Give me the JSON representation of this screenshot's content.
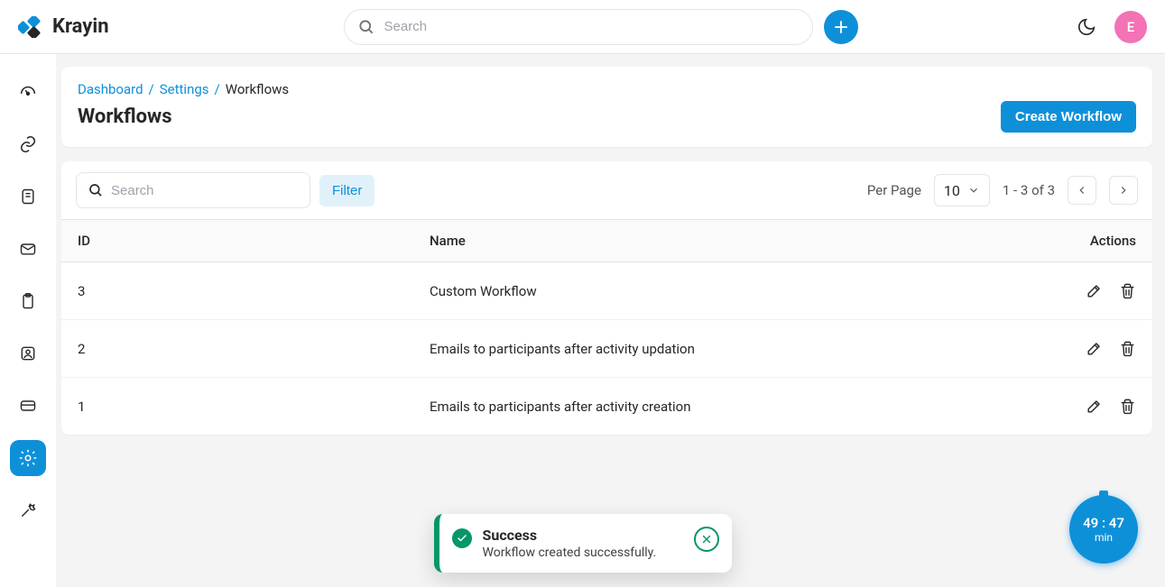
{
  "brand": {
    "name": "Krayin"
  },
  "header": {
    "search_placeholder": "Search",
    "avatar_initial": "E"
  },
  "sidebar": {
    "items": [
      {
        "name": "dashboard-icon"
      },
      {
        "name": "leads-icon"
      },
      {
        "name": "quotes-icon"
      },
      {
        "name": "mail-icon"
      },
      {
        "name": "activities-icon"
      },
      {
        "name": "contacts-icon"
      },
      {
        "name": "products-icon"
      },
      {
        "name": "settings-icon"
      },
      {
        "name": "configuration-icon"
      }
    ]
  },
  "breadcrumb": {
    "dashboard": "Dashboard",
    "settings": "Settings",
    "current": "Workflows"
  },
  "page": {
    "title": "Workflows",
    "create_btn": "Create Workflow"
  },
  "toolbar": {
    "search_placeholder": "Search",
    "filter_label": "Filter",
    "per_page_label": "Per Page",
    "per_page_value": "10",
    "range_text": "1 - 3 of 3"
  },
  "table": {
    "head": {
      "id": "ID",
      "name": "Name",
      "actions": "Actions"
    },
    "rows": [
      {
        "id": "3",
        "name": "Custom Workflow"
      },
      {
        "id": "2",
        "name": "Emails to participants after activity updation"
      },
      {
        "id": "1",
        "name": "Emails to participants after activity creation"
      }
    ]
  },
  "toast": {
    "title": "Success",
    "message": "Workflow created successfully."
  },
  "timer": {
    "time": "49 : 47",
    "unit": "min"
  }
}
